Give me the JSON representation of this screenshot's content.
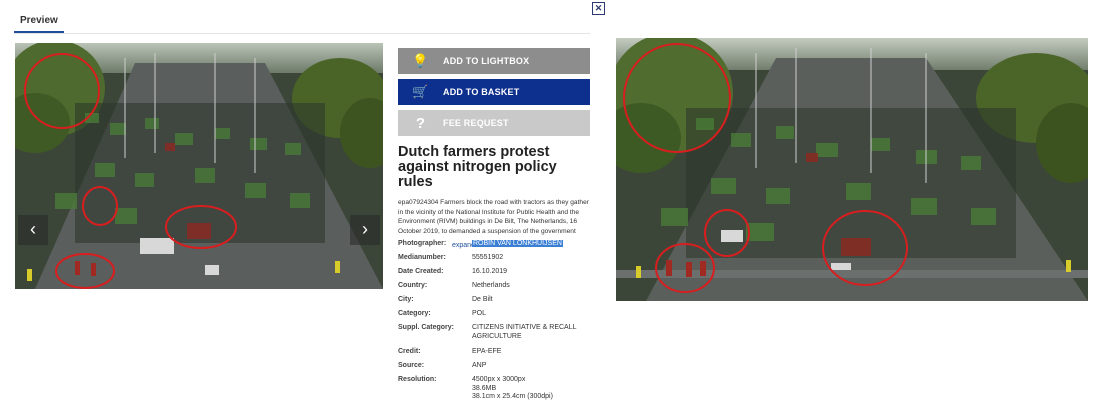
{
  "tabs": {
    "preview": "Preview"
  },
  "actions": {
    "lightbox": "ADD TO LIGHTBOX",
    "basket": "ADD TO BASKET",
    "fee_request": "FEE REQUEST",
    "fee_icon": "?"
  },
  "article": {
    "title": "Dutch farmers protest against nitrogen policy rules",
    "caption": "epa07924304 Farmers block the road with tractors as they gather in the vicinity of the National Institute for Public Health and the Environment (RIVM) buildings in De Bilt, The Netherlands, 16 October 2019, to demanded a suspension of the government",
    "expand": "expand"
  },
  "metadata": [
    {
      "key": "Photographer:",
      "value": "ROBIN VAN LONKHUIJSEN",
      "highlight": true
    },
    {
      "key": "Medianumber:",
      "value": "55551902"
    },
    {
      "key": "Date Created:",
      "value": "16.10.2019"
    },
    {
      "key": "Country:",
      "value": "Netherlands"
    },
    {
      "key": "City:",
      "value": "De Bilt"
    },
    {
      "key": "Category:",
      "value": "POL"
    },
    {
      "key": "Suppl. Category:",
      "value": "CITIZENS INITIATIVE & RECALL AGRICULTURE"
    },
    {
      "key": "Credit:",
      "value": "EPA-EFE"
    },
    {
      "key": "Source:",
      "value": "ANP"
    },
    {
      "key": "Resolution:",
      "value": "4500px x 3000px\n38.6MB\n38.1cm x 25.4cm (300dpi)"
    }
  ],
  "icons": {
    "close": "close-icon",
    "lightbox": "lightbulb-icon",
    "basket": "cart-icon",
    "prev": "chevron-left-icon",
    "next": "chevron-right-icon"
  },
  "colors": {
    "basket_button": "#0d2f8e",
    "lightbox_button": "#8d8d8d",
    "fee_button": "#c9c9c9",
    "annotation_circle": "#d81e1e",
    "tab_underline": "#1f4e9a"
  }
}
